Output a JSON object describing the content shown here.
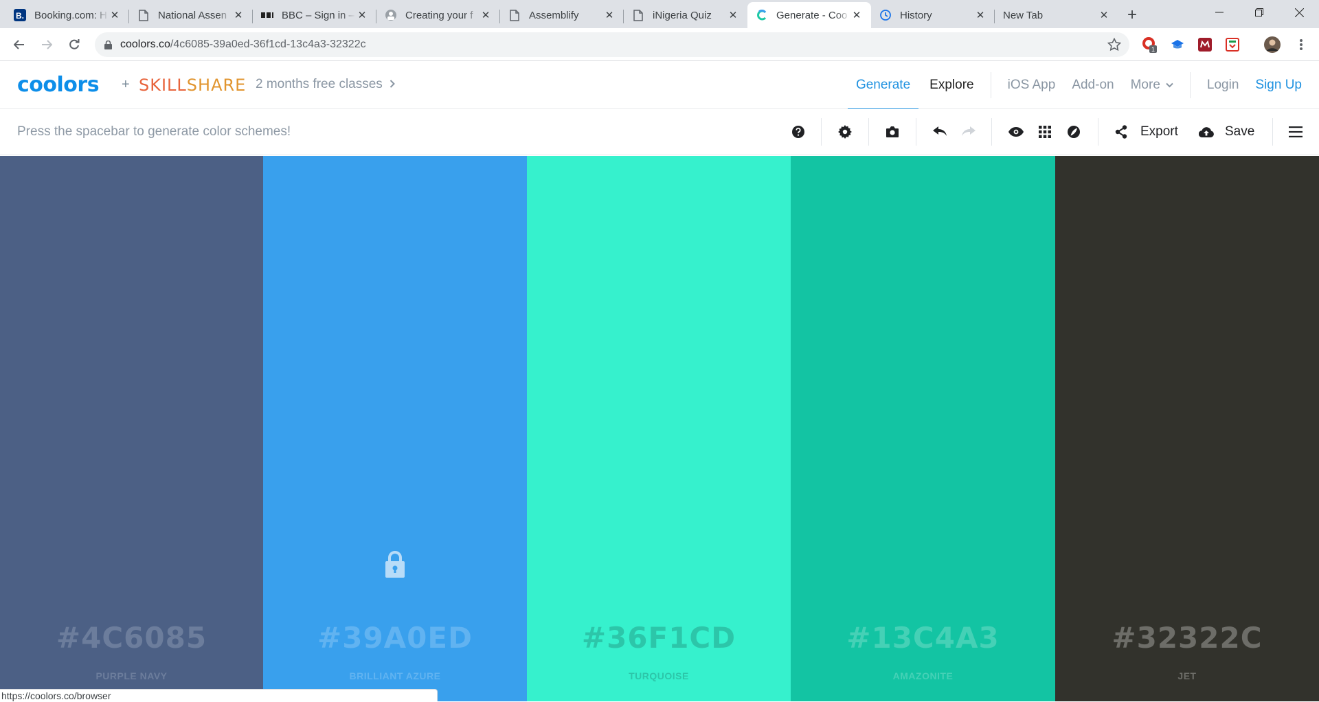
{
  "browser": {
    "tabs": [
      {
        "title": "Booking.com: H",
        "favicon": "booking-favicon",
        "active": false
      },
      {
        "title": "National Assen",
        "favicon": "page-icon",
        "active": false
      },
      {
        "title": "BBC – Sign in –",
        "favicon": "bbc-favicon",
        "active": false
      },
      {
        "title": "Creating your f",
        "favicon": "avatar-favicon",
        "active": false
      },
      {
        "title": "Assemblify",
        "favicon": "page-icon",
        "active": false
      },
      {
        "title": "iNigeria Quiz",
        "favicon": "page-icon",
        "active": false
      },
      {
        "title": "Generate - Coo",
        "favicon": "coolors-favicon",
        "active": true
      },
      {
        "title": "History",
        "favicon": "history-icon",
        "active": false
      },
      {
        "title": "New Tab",
        "favicon": "",
        "active": false
      }
    ],
    "url_host": "coolors.co",
    "url_path": "/4c6085-39a0ed-36f1cd-13c4a3-32322c",
    "extension_badge": "1",
    "status_url": "https://coolors.co/browser"
  },
  "header": {
    "logo": "coolors",
    "plus": "+",
    "partner_part1": "SKILL",
    "partner_part2": "SHARE",
    "promo": "2 months free classes",
    "nav": {
      "generate": "Generate",
      "explore": "Explore",
      "ios_app": "iOS App",
      "addon": "Add-on",
      "more": "More",
      "login": "Login",
      "signup": "Sign Up"
    }
  },
  "toolbar": {
    "hint": "Press the spacebar to generate color schemes!",
    "export_label": "Export",
    "save_label": "Save"
  },
  "palette": {
    "colors": [
      {
        "hex": "#4C6085",
        "name": "PURPLE NAVY",
        "bg": "#4c6085",
        "text": "#6c7d9c",
        "locked": false
      },
      {
        "hex": "#39A0ED",
        "name": "BRILLIANT AZURE",
        "bg": "#39a0ed",
        "text": "#61b3f1",
        "locked": true
      },
      {
        "hex": "#36F1CD",
        "name": "TURQUOISE",
        "bg": "#36f1cd",
        "text": "#2cc6a9",
        "locked": false
      },
      {
        "hex": "#13C4A3",
        "name": "AMAZONITE",
        "bg": "#13c4a3",
        "text": "#45d1b6",
        "locked": false
      },
      {
        "hex": "#32322C",
        "name": "JET",
        "bg": "#32322c",
        "text": "#6d6d68",
        "locked": false
      }
    ]
  }
}
